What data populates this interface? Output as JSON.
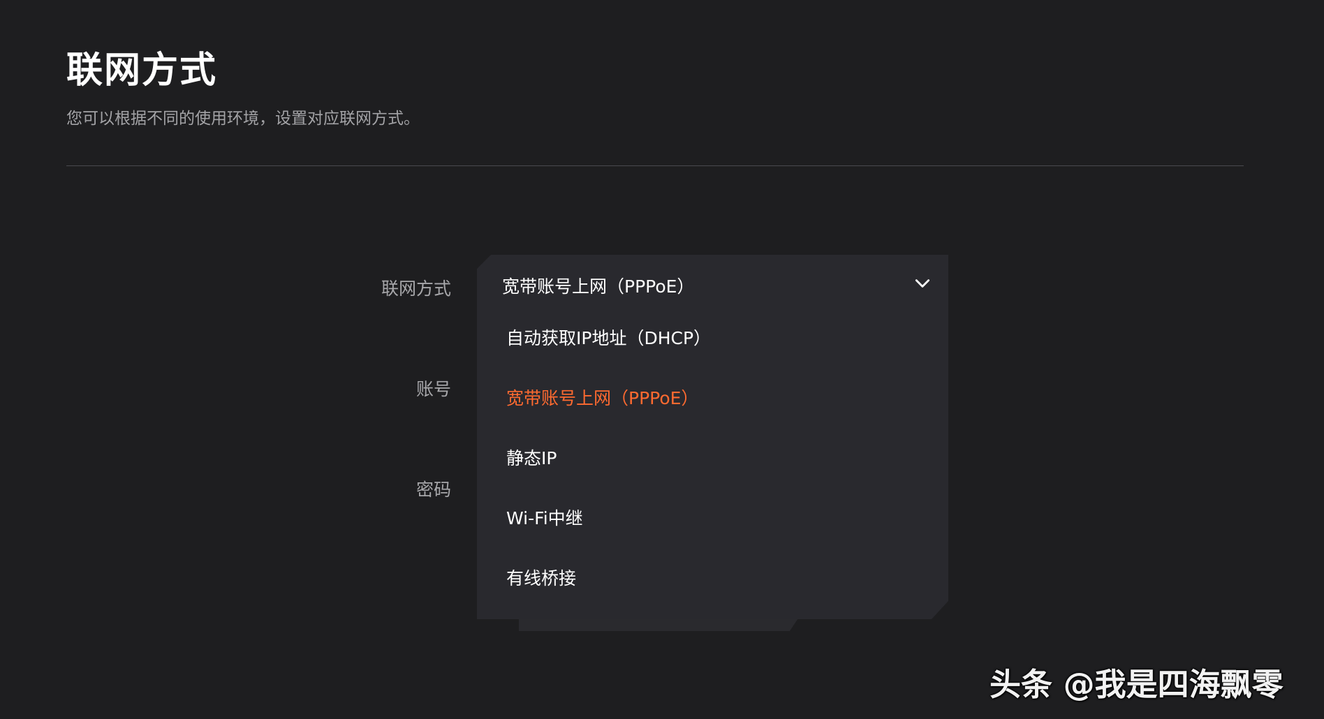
{
  "header": {
    "title": "联网方式",
    "subtitle": "您可以根据不同的使用环境，设置对应联网方式。"
  },
  "form": {
    "method_label": "联网方式",
    "account_label": "账号",
    "password_label": "密码"
  },
  "dropdown": {
    "selected_value": "宽带账号上网（PPPoE）",
    "chevron_icon": "chevron-down-icon",
    "selected_color": "#ff6a30",
    "options": [
      {
        "label": "自动获取IP地址（DHCP）"
      },
      {
        "label": "宽带账号上网（PPPoE）"
      },
      {
        "label": "静态IP"
      },
      {
        "label": "Wi-Fi中继"
      },
      {
        "label": "有线桥接"
      }
    ]
  },
  "watermark": {
    "text": "头条 @我是四海飘零"
  }
}
